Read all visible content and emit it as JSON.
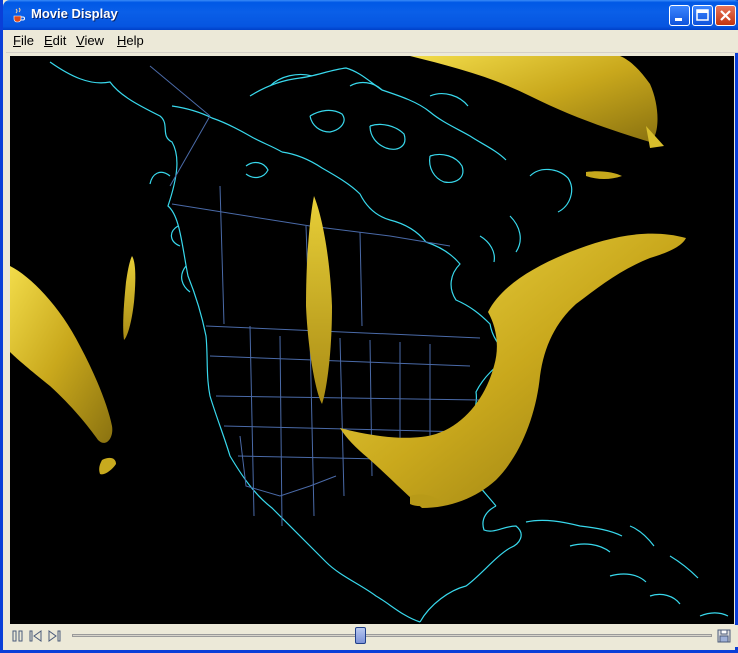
{
  "window": {
    "title": "Movie Display"
  },
  "menubar": {
    "items": [
      {
        "mnemonic": "F",
        "rest": "ile"
      },
      {
        "mnemonic": "E",
        "rest": "dit"
      },
      {
        "mnemonic": "V",
        "rest": "iew"
      },
      {
        "mnemonic": "H",
        "rest": "elp"
      }
    ]
  },
  "display": {
    "background_color": "#000000",
    "coastline_color": "#38d8ec",
    "state_border_color": "#4a6aa8",
    "isosurface_color": "#d6b626"
  },
  "controls": {
    "icons": [
      "pause-icon",
      "step-back-icon",
      "step-forward-icon",
      "animation-settings-icon"
    ],
    "timeline_position": 0.45
  }
}
